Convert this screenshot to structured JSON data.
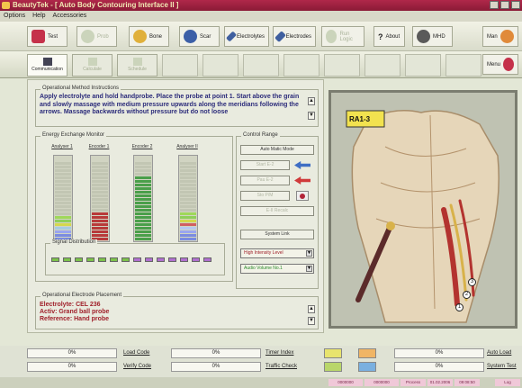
{
  "window": {
    "title": "BeautyTek - [ Auto Body Contouring Interface II ]"
  },
  "menu": [
    "Options",
    "Help",
    "Accessories"
  ],
  "toolbar": {
    "buttons": [
      {
        "label": "Test",
        "icon": "shield-icon",
        "enabled": true
      },
      {
        "label": "Prob",
        "icon": "probe-icon",
        "enabled": false
      },
      {
        "label": "Bone",
        "icon": "bone-icon",
        "enabled": true
      },
      {
        "label": "Scar",
        "icon": "scar-icon",
        "enabled": true
      },
      {
        "label": "Electrolytes",
        "icon": "electrolyte-icon",
        "enabled": true
      },
      {
        "label": "Electrodes",
        "icon": "electrode-icon",
        "enabled": true
      },
      {
        "label": "Run Logic",
        "icon": "logic-icon",
        "enabled": false
      },
      {
        "label": "About",
        "icon": "help-icon",
        "enabled": true
      },
      {
        "label": "MHD",
        "icon": "mhd-icon",
        "enabled": true
      }
    ],
    "right_label": "Man"
  },
  "tabs": [
    {
      "label": "Communication",
      "active": true,
      "enabled": true
    },
    {
      "label": "Calculate",
      "active": false,
      "enabled": false
    },
    {
      "label": "Schedule",
      "active": false,
      "enabled": false
    }
  ],
  "menu_button": "Menu",
  "instructions": {
    "title": "Operational Method Instructions",
    "text": "Apply electrolyte and hold handprobe. Place the probe at point 1. Start above the grain and slowly massage with medium pressure upwards along the meridians following the arrows. Massage backwards without pressure but do not loose"
  },
  "energy_monitor": {
    "title": "Energy Exchange Monitor",
    "meters": [
      {
        "label": "Analyser 1",
        "segments": [
          "#7a8be0",
          "#7a8be0",
          "#9aa5f0",
          "#a6cce0",
          "#d4d84c",
          "#8fcf5a",
          "#9fd85a"
        ]
      },
      {
        "label": "Encoder 1",
        "segments": [
          "#b83a3a",
          "#b83a3a",
          "#b83a3a",
          "#b83a3a",
          "#b83a3a",
          "#b83a3a",
          "#b83a3a",
          "#b83a3a"
        ]
      },
      {
        "label": "Encoder 2",
        "segments": [
          "#4a9f4a",
          "#4a9f4a",
          "#4a9f4a",
          "#4a9f4a",
          "#4a9f4a",
          "#4a9f4a",
          "#4a9f4a",
          "#4a9f4a",
          "#4a9f4a",
          "#4a9f4a",
          "#4a9f4a",
          "#4a9f4a",
          "#4a9f4a",
          "#4a9f4a",
          "#4a9f4a",
          "#4a9f4a",
          "#4a9f4a",
          "#4a9f4a"
        ]
      },
      {
        "label": "Analyser II",
        "segments": [
          "#7a8be0",
          "#7a8be0",
          "#9aa5f0",
          "#b7c8f0",
          "#d16060",
          "#d4d84c",
          "#8fcf5a",
          "#9fd85a"
        ]
      }
    ],
    "distribution_title": "Signal Distribution"
  },
  "control_range": {
    "title": "Control Range",
    "automatic_mode": "Auto Matic Mode",
    "buttons": [
      "Start E-2",
      "Pau E-2",
      "Sto P/M",
      "E-II Recalc"
    ],
    "system_link": "System Link",
    "intensity": "High Intensity Level",
    "audio": "Audio Volume No.1"
  },
  "electrode_placement": {
    "title": "Operational Electrode Placement",
    "lines": [
      "Electrolyte: CEL 236",
      "Activ: Grand ball probe",
      "Reference: Hand probe"
    ]
  },
  "image": {
    "tag": "RA1-3",
    "points": [
      "1",
      "2",
      "3"
    ]
  },
  "bottom": {
    "row1": [
      {
        "value": "0%"
      },
      {
        "label": "Load Code"
      },
      {
        "value": "0%"
      },
      {
        "label": "Timer Index"
      },
      {
        "value": "0%"
      },
      {
        "label": "Auto Load"
      }
    ],
    "row2": [
      {
        "value": "0%"
      },
      {
        "label": "Verify Code"
      },
      {
        "value": "0%"
      },
      {
        "label": "Traffic Check"
      },
      {
        "value": "0%"
      },
      {
        "label": "System Test"
      }
    ]
  },
  "statusbar": [
    "0000000",
    "0000000",
    "Process",
    "01.02.2006",
    "09:08:50",
    "Log"
  ]
}
